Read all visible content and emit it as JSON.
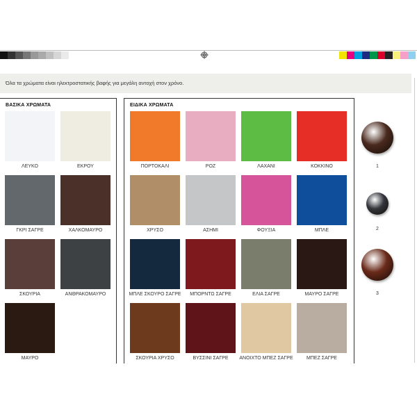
{
  "registration_bar": {
    "grays": [
      "#111111",
      "#333333",
      "#555555",
      "#777777",
      "#999999",
      "#aaaaaa",
      "#c0c0c0",
      "#d6d6d6",
      "#eaeaea"
    ],
    "colors": [
      "#f2e400",
      "#e4007e",
      "#00a0e0",
      "#1e2a80",
      "#00964a",
      "#d9002a",
      "#222222",
      "#f7f07a",
      "#f4a0c8",
      "#8fd0f0"
    ]
  },
  "notice": {
    "text": "Όλα τα χρώματα είναι ηλεκτροστατικής βαφής για μεγάλη αντοχή στον χρόνο."
  },
  "basic": {
    "title": "ΒΑΣΙΚΑ ΧΡΩΜΑΤΑ",
    "items": [
      {
        "label": "ΛΕΥΚΟ",
        "color": "#f2f4f8"
      },
      {
        "label": "ΕΚΡΟΥ",
        "color": "#efece2"
      },
      {
        "label": "ΓΚΡΙ ΣΑΓΡΕ",
        "color": "#62686c"
      },
      {
        "label": "ΧΑΛΚΟΜΑΥΡΟ",
        "color": "#4a3028"
      },
      {
        "label": "ΣΚΟΥΡΙΑ",
        "color": "#5a3e3a"
      },
      {
        "label": "ΑΝΘΡΑΚΟΜΑΥΡΟ",
        "color": "#3e4144"
      },
      {
        "label": "ΜΑΥΡΟ",
        "color": "#2a1a12"
      }
    ]
  },
  "special": {
    "title": "ΕΙΔΙΚΑ ΧΡΩΜΑΤΑ",
    "items": [
      {
        "label": "ΠΟΡΤΟΚΑΛΙ",
        "color": "#f07a2a"
      },
      {
        "label": "ΡΟΖ",
        "color": "#e8adc0"
      },
      {
        "label": "ΛΑΧΑΝΙ",
        "color": "#5cbc44"
      },
      {
        "label": "ΚΟΚΚΙΝΟ",
        "color": "#e62e26"
      },
      {
        "label": "ΧΡΥΣΟ",
        "color": "#b08e68"
      },
      {
        "label": "ΑΣΗΜΙ",
        "color": "#c4c6c8"
      },
      {
        "label": "ΦΟΥΞΙΑ",
        "color": "#d6549a"
      },
      {
        "label": "ΜΠΛΕ",
        "color": "#0e4e9a"
      },
      {
        "label": "ΜΠΛΕ ΣΚΟΥΡΟ ΣΑΓΡΕ",
        "color": "#14283e"
      },
      {
        "label": "ΜΠΟΡΝΤΩ ΣΑΓΡΕ",
        "color": "#7e1a1e"
      },
      {
        "label": "ΕΛΙΑ ΣΑΓΡΕ",
        "color": "#7a7d6c"
      },
      {
        "label": "ΜΑΥΡΟ ΣΑΓΡΕ",
        "color": "#2a1814"
      },
      {
        "label": "ΣΚΟΥΡΙΑ ΧΡΥΣΟ",
        "color": "#6e3a1e"
      },
      {
        "label": "ΒΥΣΣΙΝΙ ΣΑΓΡΕ",
        "color": "#5e1418"
      },
      {
        "label": "ΑΝΟΙΧΤΟ ΜΠΕΖ ΣΑΓΡΕ",
        "color": "#dfc8a2"
      },
      {
        "label": "ΜΠΕΖ ΣΑΓΡΕ",
        "color": "#b9aca1"
      }
    ]
  },
  "knobs": [
    {
      "label": "1",
      "color": "#4a2a1e"
    },
    {
      "label": "2",
      "color": "#33363c"
    },
    {
      "label": "3",
      "color": "#6a2a1a"
    }
  ]
}
